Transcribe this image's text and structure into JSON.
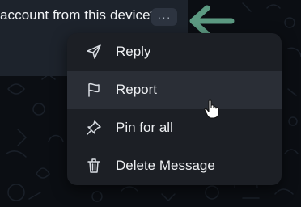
{
  "message": {
    "text": "account from this device?"
  },
  "more_button": {
    "icon": "ellipsis-icon",
    "glyph": "···"
  },
  "indicator": {
    "icon": "arrow-left-icon",
    "color": "#5c9a82"
  },
  "context_menu": {
    "items": [
      {
        "label": "Reply",
        "icon": "send-icon"
      },
      {
        "label": "Report",
        "icon": "flag-icon"
      },
      {
        "label": "Pin for all",
        "icon": "pin-icon"
      },
      {
        "label": "Delete Message",
        "icon": "trash-icon"
      }
    ],
    "hovered_item": "Report"
  },
  "colors": {
    "background": "#0b0e13",
    "menu_background": "#1c1f25",
    "menu_hover": "#2a2e36",
    "text": "#eef0f3"
  }
}
